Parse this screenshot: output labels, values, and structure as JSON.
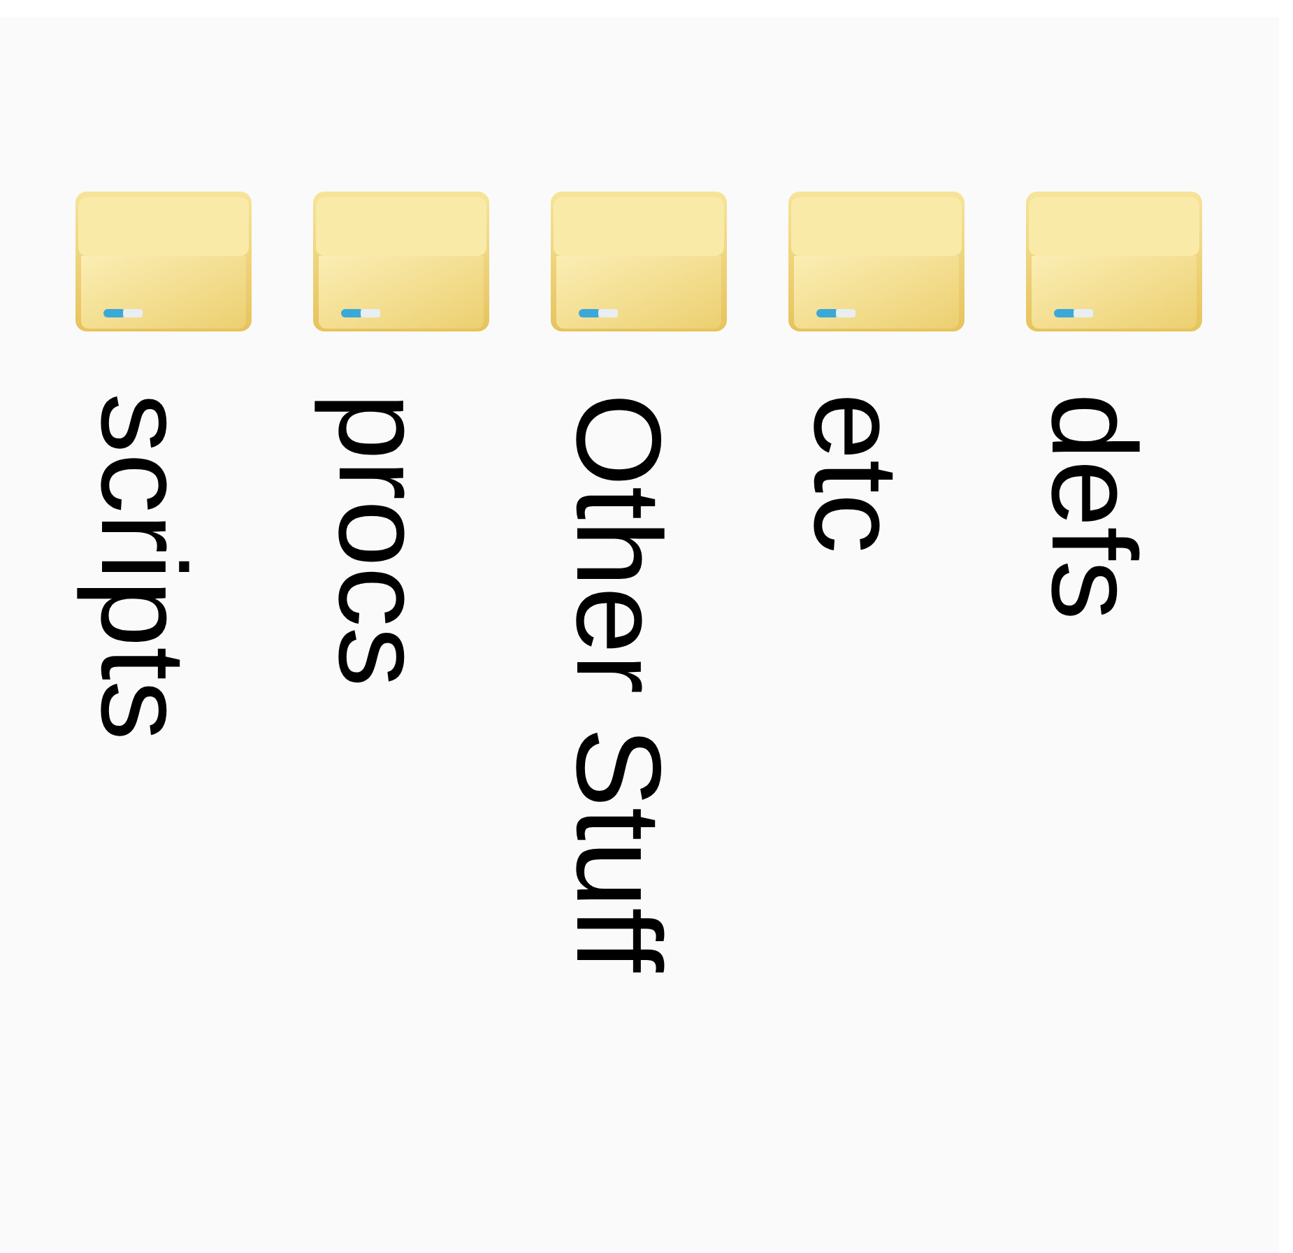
{
  "folders": [
    {
      "name": "scripts"
    },
    {
      "name": "procs"
    },
    {
      "name": "Other Stuff"
    },
    {
      "name": "etc"
    },
    {
      "name": "defs"
    }
  ]
}
